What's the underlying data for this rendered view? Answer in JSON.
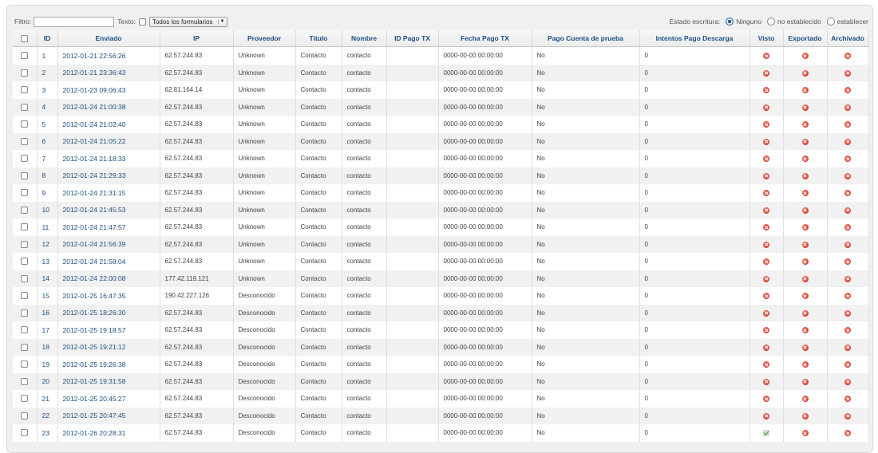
{
  "toolbar": {
    "filter_label": "Filtro:",
    "filter_value": "",
    "text_label": "Texto:",
    "form_select": "Todos los formularios",
    "state_label": "Estado escritura:",
    "state_options": [
      "Ninguno",
      "no establecido",
      "establecer"
    ],
    "state_selected": "Ninguno"
  },
  "columns": [
    "ID",
    "Enviado",
    "IP",
    "Proveedor",
    "Titulo",
    "Nombre",
    "ID Pago TX",
    "Fecha Pago TX",
    "Pago Cuenta de prueba",
    "Intentos Pago Descarga",
    "Visto",
    "Exportado",
    "Archivado"
  ],
  "rows": [
    {
      "id": "1",
      "enviado": "2012-01-21 22:56:26",
      "ip": "62.57.244.83",
      "proveedor": "Unknown",
      "titulo": "Contacto",
      "nombre": "contacto",
      "id_pago_tx": "",
      "fecha_pago_tx": "0000-00-00 00:00:00",
      "pago_cuenta_prueba": "No",
      "intentos": "0",
      "visto": "no",
      "exportado": "no",
      "archivado": "no"
    },
    {
      "id": "2",
      "enviado": "2012-01-21 23:36:43",
      "ip": "62.57.244.83",
      "proveedor": "Unknown",
      "titulo": "Contacto",
      "nombre": "contacto",
      "id_pago_tx": "",
      "fecha_pago_tx": "0000-00-00 00:00:00",
      "pago_cuenta_prueba": "No",
      "intentos": "0",
      "visto": "no",
      "exportado": "no",
      "archivado": "no"
    },
    {
      "id": "3",
      "enviado": "2012-01-23 09:06:43",
      "ip": "62.81.164.14",
      "proveedor": "Unknown",
      "titulo": "Contacto",
      "nombre": "contacto",
      "id_pago_tx": "",
      "fecha_pago_tx": "0000-00-00 00:00:00",
      "pago_cuenta_prueba": "No",
      "intentos": "0",
      "visto": "no",
      "exportado": "no",
      "archivado": "no"
    },
    {
      "id": "4",
      "enviado": "2012-01-24 21:00:38",
      "ip": "62.57.244.83",
      "proveedor": "Unknown",
      "titulo": "Contacto",
      "nombre": "contacto",
      "id_pago_tx": "",
      "fecha_pago_tx": "0000-00-00 00:00:00",
      "pago_cuenta_prueba": "No",
      "intentos": "0",
      "visto": "no",
      "exportado": "no",
      "archivado": "no"
    },
    {
      "id": "5",
      "enviado": "2012-01-24 21:02:40",
      "ip": "62.57.244.83",
      "proveedor": "Unknown",
      "titulo": "Contacto",
      "nombre": "contacto",
      "id_pago_tx": "",
      "fecha_pago_tx": "0000-00-00 00:00:00",
      "pago_cuenta_prueba": "No",
      "intentos": "0",
      "visto": "no",
      "exportado": "no",
      "archivado": "no"
    },
    {
      "id": "6",
      "enviado": "2012-01-24 21:05:22",
      "ip": "62.57.244.83",
      "proveedor": "Unknown",
      "titulo": "Contacto",
      "nombre": "contacto",
      "id_pago_tx": "",
      "fecha_pago_tx": "0000-00-00 00:00:00",
      "pago_cuenta_prueba": "No",
      "intentos": "0",
      "visto": "no",
      "exportado": "no",
      "archivado": "no"
    },
    {
      "id": "7",
      "enviado": "2012-01-24 21:18:33",
      "ip": "62.57.244.83",
      "proveedor": "Unknown",
      "titulo": "Contacto",
      "nombre": "contacto",
      "id_pago_tx": "",
      "fecha_pago_tx": "0000-00-00 00:00:00",
      "pago_cuenta_prueba": "No",
      "intentos": "0",
      "visto": "no",
      "exportado": "no",
      "archivado": "no"
    },
    {
      "id": "8",
      "enviado": "2012-01-24 21:29:33",
      "ip": "62.57.244.83",
      "proveedor": "Unknown",
      "titulo": "Contacto",
      "nombre": "contacto",
      "id_pago_tx": "",
      "fecha_pago_tx": "0000-00-00 00:00:00",
      "pago_cuenta_prueba": "No",
      "intentos": "0",
      "visto": "no",
      "exportado": "no",
      "archivado": "no"
    },
    {
      "id": "9",
      "enviado": "2012-01-24 21:31:15",
      "ip": "62.57.244.83",
      "proveedor": "Unknown",
      "titulo": "Contacto",
      "nombre": "contacto",
      "id_pago_tx": "",
      "fecha_pago_tx": "0000-00-00 00:00:00",
      "pago_cuenta_prueba": "No",
      "intentos": "0",
      "visto": "no",
      "exportado": "no",
      "archivado": "no"
    },
    {
      "id": "10",
      "enviado": "2012-01-24 21:45:53",
      "ip": "62.57.244.83",
      "proveedor": "Unknown",
      "titulo": "Contacto",
      "nombre": "contacto",
      "id_pago_tx": "",
      "fecha_pago_tx": "0000-00-00 00:00:00",
      "pago_cuenta_prueba": "No",
      "intentos": "0",
      "visto": "no",
      "exportado": "no",
      "archivado": "no"
    },
    {
      "id": "11",
      "enviado": "2012-01-24 21:47:57",
      "ip": "62.57.244.83",
      "proveedor": "Unknown",
      "titulo": "Contacto",
      "nombre": "contacto",
      "id_pago_tx": "",
      "fecha_pago_tx": "0000-00-00 00:00:00",
      "pago_cuenta_prueba": "No",
      "intentos": "0",
      "visto": "no",
      "exportado": "no",
      "archivado": "no"
    },
    {
      "id": "12",
      "enviado": "2012-01-24 21:56:39",
      "ip": "62.57.244.83",
      "proveedor": "Unknown",
      "titulo": "Contacto",
      "nombre": "contacto",
      "id_pago_tx": "",
      "fecha_pago_tx": "0000-00-00 00:00:00",
      "pago_cuenta_prueba": "No",
      "intentos": "0",
      "visto": "no",
      "exportado": "no",
      "archivado": "no"
    },
    {
      "id": "13",
      "enviado": "2012-01-24 21:58:04",
      "ip": "62.57.244.83",
      "proveedor": "Unknown",
      "titulo": "Contacto",
      "nombre": "contacto",
      "id_pago_tx": "",
      "fecha_pago_tx": "0000-00-00 00:00:00",
      "pago_cuenta_prueba": "No",
      "intentos": "0",
      "visto": "no",
      "exportado": "no",
      "archivado": "no"
    },
    {
      "id": "14",
      "enviado": "2012-01-24 22:00:08",
      "ip": "177.42.119.121",
      "proveedor": "Unknown",
      "titulo": "Contacto",
      "nombre": "contacto",
      "id_pago_tx": "",
      "fecha_pago_tx": "0000-00-00 00:00:00",
      "pago_cuenta_prueba": "No",
      "intentos": "0",
      "visto": "no",
      "exportado": "no",
      "archivado": "no"
    },
    {
      "id": "15",
      "enviado": "2012-01-25 16:47:35",
      "ip": "190.42.227.126",
      "proveedor": "Desconocido",
      "titulo": "Contacto",
      "nombre": "contacto",
      "id_pago_tx": "",
      "fecha_pago_tx": "0000-00-00 00:00:00",
      "pago_cuenta_prueba": "No",
      "intentos": "0",
      "visto": "no",
      "exportado": "no",
      "archivado": "no"
    },
    {
      "id": "16",
      "enviado": "2012-01-25 18:26:30",
      "ip": "62.57.244.83",
      "proveedor": "Desconocido",
      "titulo": "Contacto",
      "nombre": "contacto",
      "id_pago_tx": "",
      "fecha_pago_tx": "0000-00-00 00:00:00",
      "pago_cuenta_prueba": "No",
      "intentos": "0",
      "visto": "no",
      "exportado": "no",
      "archivado": "no"
    },
    {
      "id": "17",
      "enviado": "2012-01-25 19:18:57",
      "ip": "62.57.244.83",
      "proveedor": "Desconocido",
      "titulo": "Contacto",
      "nombre": "contacto",
      "id_pago_tx": "",
      "fecha_pago_tx": "0000-00-00 00:00:00",
      "pago_cuenta_prueba": "No",
      "intentos": "0",
      "visto": "no",
      "exportado": "no",
      "archivado": "no"
    },
    {
      "id": "18",
      "enviado": "2012-01-25 19:21:12",
      "ip": "62.57.244.83",
      "proveedor": "Desconocido",
      "titulo": "Contacto",
      "nombre": "contacto",
      "id_pago_tx": "",
      "fecha_pago_tx": "0000-00-00 00:00:00",
      "pago_cuenta_prueba": "No",
      "intentos": "0",
      "visto": "no",
      "exportado": "no",
      "archivado": "no"
    },
    {
      "id": "19",
      "enviado": "2012-01-25 19:26:38",
      "ip": "62.57.244.83",
      "proveedor": "Desconocido",
      "titulo": "Contacto",
      "nombre": "contacto",
      "id_pago_tx": "",
      "fecha_pago_tx": "0000-00-00 00:00:00",
      "pago_cuenta_prueba": "No",
      "intentos": "0",
      "visto": "no",
      "exportado": "no",
      "archivado": "no"
    },
    {
      "id": "20",
      "enviado": "2012-01-25 19:31:58",
      "ip": "62.57.244.83",
      "proveedor": "Desconocido",
      "titulo": "Contacto",
      "nombre": "contacto",
      "id_pago_tx": "",
      "fecha_pago_tx": "0000-00-00 00:00:00",
      "pago_cuenta_prueba": "No",
      "intentos": "0",
      "visto": "no",
      "exportado": "no",
      "archivado": "no"
    },
    {
      "id": "21",
      "enviado": "2012-01-25 20:45:27",
      "ip": "62.57.244.83",
      "proveedor": "Desconocido",
      "titulo": "Contacto",
      "nombre": "contacto",
      "id_pago_tx": "",
      "fecha_pago_tx": "0000-00-00 00:00:00",
      "pago_cuenta_prueba": "No",
      "intentos": "0",
      "visto": "no",
      "exportado": "no",
      "archivado": "no"
    },
    {
      "id": "22",
      "enviado": "2012-01-25 20:47:45",
      "ip": "62.57.244.83",
      "proveedor": "Desconocido",
      "titulo": "Contacto",
      "nombre": "contacto",
      "id_pago_tx": "",
      "fecha_pago_tx": "0000-00-00 00:00:00",
      "pago_cuenta_prueba": "No",
      "intentos": "0",
      "visto": "no",
      "exportado": "no",
      "archivado": "no"
    },
    {
      "id": "23",
      "enviado": "2012-01-26 20:28:31",
      "ip": "62.57.244.83",
      "proveedor": "Desconocido",
      "titulo": "Contacto",
      "nombre": "contacto",
      "id_pago_tx": "",
      "fecha_pago_tx": "0000-00-00 00:00:00",
      "pago_cuenta_prueba": "No",
      "intentos": "0",
      "visto": "yes",
      "exportado": "no",
      "archivado": "no"
    }
  ]
}
